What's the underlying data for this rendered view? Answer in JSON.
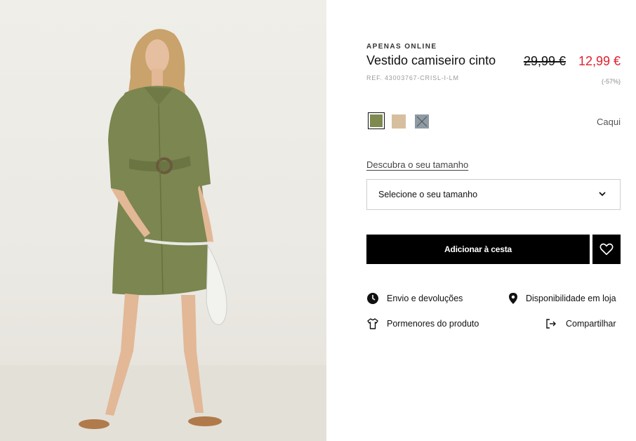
{
  "product": {
    "online_tag": "APENAS ONLINE",
    "title": "Vestido camiseiro cinto",
    "reference": "REF. 43003767-CRISL-I-LM",
    "old_price": "29,99 €",
    "new_price": "12,99 €",
    "discount": "(-57%)",
    "price_color": "#e0202e"
  },
  "colors": {
    "selected_name": "Caqui",
    "swatches": [
      {
        "name": "khaki",
        "hex": "#7e8a4f",
        "selected": true
      },
      {
        "name": "beige",
        "hex": "#d6bf9f",
        "selected": false
      },
      {
        "name": "grey",
        "hex": "#8f9aa3",
        "selected": false,
        "unavailable": true
      }
    ]
  },
  "size": {
    "guide_link": "Descubra o seu tamanho",
    "select_placeholder": "Selecione o seu tamanho"
  },
  "actions": {
    "add_to_cart": "Adicionar à cesta",
    "wishlist_icon": "heart-icon"
  },
  "info_links": {
    "shipping": {
      "label": "Envio e devoluções",
      "icon": "clock-icon"
    },
    "store_availability": {
      "label": "Disponibilidade em loja",
      "icon": "location-pin-icon"
    },
    "product_details": {
      "label": "Pormenores do produto",
      "icon": "tshirt-icon"
    },
    "share": {
      "label": "Compartilhar",
      "icon": "share-icon"
    }
  }
}
